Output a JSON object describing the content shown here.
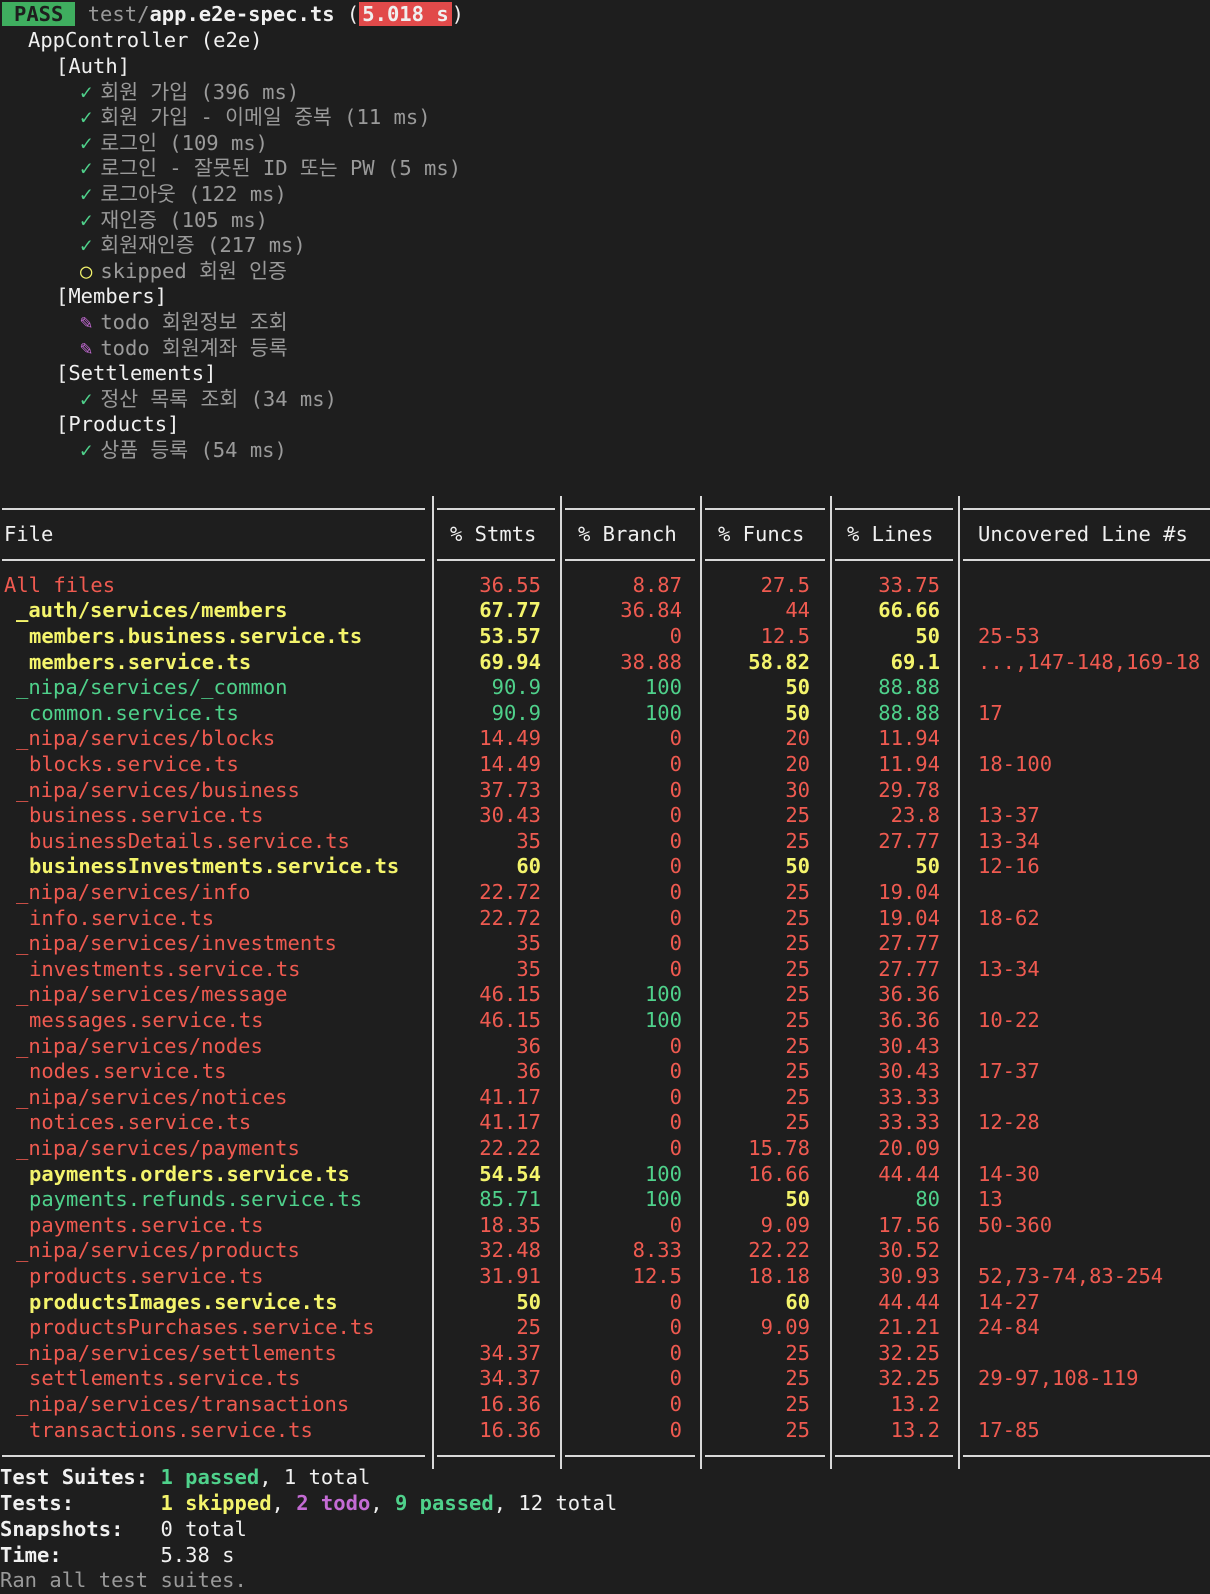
{
  "header": {
    "badge": "PASS",
    "path_dir": "test/",
    "path_file": "app.e2e-spec.ts",
    "open_paren": " (",
    "duration": "5.018 s",
    "close_paren": ")"
  },
  "suite": "AppController (e2e)",
  "groups": [
    {
      "name": "[Auth]",
      "tests": [
        {
          "mark": "✓",
          "status": "passed",
          "text": "회원 가입 (396 ms)"
        },
        {
          "mark": "✓",
          "status": "passed",
          "text": "회원 가입 - 이메일 중복 (11 ms)"
        },
        {
          "mark": "✓",
          "status": "passed",
          "text": "로그인 (109 ms)"
        },
        {
          "mark": "✓",
          "status": "passed",
          "text": "로그인 - 잘못된 ID 또는 PW (5 ms)"
        },
        {
          "mark": "✓",
          "status": "passed",
          "text": "로그아웃 (122 ms)"
        },
        {
          "mark": "✓",
          "status": "passed",
          "text": "재인증 (105 ms)"
        },
        {
          "mark": "✓",
          "status": "passed",
          "text": "회원재인증 (217 ms)"
        },
        {
          "mark": "○",
          "status": "skipped",
          "text": "skipped 회원 인증"
        }
      ]
    },
    {
      "name": "[Members]",
      "tests": [
        {
          "mark": "✎",
          "status": "todo",
          "text": "todo 회원정보 조회"
        },
        {
          "mark": "✎",
          "status": "todo",
          "text": "todo 회원계좌 등록"
        }
      ]
    },
    {
      "name": "[Settlements]",
      "tests": [
        {
          "mark": "✓",
          "status": "passed",
          "text": "정산 목록 조회 (34 ms)"
        }
      ]
    },
    {
      "name": "[Products]",
      "tests": [
        {
          "mark": "✓",
          "status": "passed",
          "text": "상품 등록 (54 ms)"
        }
      ]
    }
  ],
  "coverage": {
    "headers": [
      "File",
      "% Stmts",
      "% Branch",
      "% Funcs",
      "% Lines",
      "Uncovered Line #s"
    ],
    "rows": [
      {
        "file": "All files",
        "indent": 0,
        "color": "red",
        "bold": false,
        "stmts": "36.55",
        "branch": "8.87",
        "funcs": "27.5",
        "lines": "33.75",
        "uncovered": "",
        "colors": [
          "red",
          "red",
          "red",
          "red"
        ]
      },
      {
        "file": "_auth/services/members",
        "indent": 1,
        "color": "yellow",
        "bold": true,
        "stmts": "67.77",
        "branch": "36.84",
        "funcs": "44",
        "lines": "66.66",
        "uncovered": "",
        "colors": [
          "yellow",
          "red",
          "red",
          "yellow"
        ]
      },
      {
        "file": "members.business.service.ts",
        "indent": 2,
        "color": "yellow",
        "bold": true,
        "stmts": "53.57",
        "branch": "0",
        "funcs": "12.5",
        "lines": "50",
        "uncovered": "25-53",
        "colors": [
          "yellow",
          "red",
          "red",
          "yellow"
        ]
      },
      {
        "file": "members.service.ts",
        "indent": 2,
        "color": "yellow",
        "bold": true,
        "stmts": "69.94",
        "branch": "38.88",
        "funcs": "58.82",
        "lines": "69.1",
        "uncovered": "...,147-148,169-18",
        "colors": [
          "yellow",
          "red",
          "yellow",
          "yellow"
        ]
      },
      {
        "file": "_nipa/services/_common",
        "indent": 1,
        "color": "green",
        "bold": false,
        "stmts": "90.9",
        "branch": "100",
        "funcs": "50",
        "lines": "88.88",
        "uncovered": "",
        "colors": [
          "green",
          "green",
          "yellow",
          "green"
        ]
      },
      {
        "file": "common.service.ts",
        "indent": 2,
        "color": "green",
        "bold": false,
        "stmts": "90.9",
        "branch": "100",
        "funcs": "50",
        "lines": "88.88",
        "uncovered": "17",
        "colors": [
          "green",
          "green",
          "yellow",
          "green"
        ]
      },
      {
        "file": "_nipa/services/blocks",
        "indent": 1,
        "color": "red",
        "bold": false,
        "stmts": "14.49",
        "branch": "0",
        "funcs": "20",
        "lines": "11.94",
        "uncovered": "",
        "colors": [
          "red",
          "red",
          "red",
          "red"
        ]
      },
      {
        "file": "blocks.service.ts",
        "indent": 2,
        "color": "red",
        "bold": false,
        "stmts": "14.49",
        "branch": "0",
        "funcs": "20",
        "lines": "11.94",
        "uncovered": "18-100",
        "colors": [
          "red",
          "red",
          "red",
          "red"
        ]
      },
      {
        "file": "_nipa/services/business",
        "indent": 1,
        "color": "red",
        "bold": false,
        "stmts": "37.73",
        "branch": "0",
        "funcs": "30",
        "lines": "29.78",
        "uncovered": "",
        "colors": [
          "red",
          "red",
          "red",
          "red"
        ]
      },
      {
        "file": "business.service.ts",
        "indent": 2,
        "color": "red",
        "bold": false,
        "stmts": "30.43",
        "branch": "0",
        "funcs": "25",
        "lines": "23.8",
        "uncovered": "13-37",
        "colors": [
          "red",
          "red",
          "red",
          "red"
        ]
      },
      {
        "file": "businessDetails.service.ts",
        "indent": 2,
        "color": "red",
        "bold": false,
        "stmts": "35",
        "branch": "0",
        "funcs": "25",
        "lines": "27.77",
        "uncovered": "13-34",
        "colors": [
          "red",
          "red",
          "red",
          "red"
        ]
      },
      {
        "file": "businessInvestments.service.ts",
        "indent": 2,
        "color": "yellow",
        "bold": true,
        "stmts": "60",
        "branch": "0",
        "funcs": "50",
        "lines": "50",
        "uncovered": "12-16",
        "colors": [
          "yellow",
          "red",
          "yellow",
          "yellow"
        ]
      },
      {
        "file": "_nipa/services/info",
        "indent": 1,
        "color": "red",
        "bold": false,
        "stmts": "22.72",
        "branch": "0",
        "funcs": "25",
        "lines": "19.04",
        "uncovered": "",
        "colors": [
          "red",
          "red",
          "red",
          "red"
        ]
      },
      {
        "file": "info.service.ts",
        "indent": 2,
        "color": "red",
        "bold": false,
        "stmts": "22.72",
        "branch": "0",
        "funcs": "25",
        "lines": "19.04",
        "uncovered": "18-62",
        "colors": [
          "red",
          "red",
          "red",
          "red"
        ]
      },
      {
        "file": "_nipa/services/investments",
        "indent": 1,
        "color": "red",
        "bold": false,
        "stmts": "35",
        "branch": "0",
        "funcs": "25",
        "lines": "27.77",
        "uncovered": "",
        "colors": [
          "red",
          "red",
          "red",
          "red"
        ]
      },
      {
        "file": "investments.service.ts",
        "indent": 2,
        "color": "red",
        "bold": false,
        "stmts": "35",
        "branch": "0",
        "funcs": "25",
        "lines": "27.77",
        "uncovered": "13-34",
        "colors": [
          "red",
          "red",
          "red",
          "red"
        ]
      },
      {
        "file": "_nipa/services/message",
        "indent": 1,
        "color": "red",
        "bold": false,
        "stmts": "46.15",
        "branch": "100",
        "funcs": "25",
        "lines": "36.36",
        "uncovered": "",
        "colors": [
          "red",
          "green",
          "red",
          "red"
        ]
      },
      {
        "file": "messages.service.ts",
        "indent": 2,
        "color": "red",
        "bold": false,
        "stmts": "46.15",
        "branch": "100",
        "funcs": "25",
        "lines": "36.36",
        "uncovered": "10-22",
        "colors": [
          "red",
          "green",
          "red",
          "red"
        ]
      },
      {
        "file": "_nipa/services/nodes",
        "indent": 1,
        "color": "red",
        "bold": false,
        "stmts": "36",
        "branch": "0",
        "funcs": "25",
        "lines": "30.43",
        "uncovered": "",
        "colors": [
          "red",
          "red",
          "red",
          "red"
        ]
      },
      {
        "file": "nodes.service.ts",
        "indent": 2,
        "color": "red",
        "bold": false,
        "stmts": "36",
        "branch": "0",
        "funcs": "25",
        "lines": "30.43",
        "uncovered": "17-37",
        "colors": [
          "red",
          "red",
          "red",
          "red"
        ]
      },
      {
        "file": "_nipa/services/notices",
        "indent": 1,
        "color": "red",
        "bold": false,
        "stmts": "41.17",
        "branch": "0",
        "funcs": "25",
        "lines": "33.33",
        "uncovered": "",
        "colors": [
          "red",
          "red",
          "red",
          "red"
        ]
      },
      {
        "file": "notices.service.ts",
        "indent": 2,
        "color": "red",
        "bold": false,
        "stmts": "41.17",
        "branch": "0",
        "funcs": "25",
        "lines": "33.33",
        "uncovered": "12-28",
        "colors": [
          "red",
          "red",
          "red",
          "red"
        ]
      },
      {
        "file": "_nipa/services/payments",
        "indent": 1,
        "color": "red",
        "bold": false,
        "stmts": "22.22",
        "branch": "0",
        "funcs": "15.78",
        "lines": "20.09",
        "uncovered": "",
        "colors": [
          "red",
          "red",
          "red",
          "red"
        ]
      },
      {
        "file": "payments.orders.service.ts",
        "indent": 2,
        "color": "yellow",
        "bold": true,
        "stmts": "54.54",
        "branch": "100",
        "funcs": "16.66",
        "lines": "44.44",
        "uncovered": "14-30",
        "colors": [
          "yellow",
          "green",
          "red",
          "red"
        ]
      },
      {
        "file": "payments.refunds.service.ts",
        "indent": 2,
        "color": "green",
        "bold": false,
        "stmts": "85.71",
        "branch": "100",
        "funcs": "50",
        "lines": "80",
        "uncovered": "13",
        "colors": [
          "green",
          "green",
          "yellow",
          "green"
        ]
      },
      {
        "file": "payments.service.ts",
        "indent": 2,
        "color": "red",
        "bold": false,
        "stmts": "18.35",
        "branch": "0",
        "funcs": "9.09",
        "lines": "17.56",
        "uncovered": "50-360",
        "colors": [
          "red",
          "red",
          "red",
          "red"
        ]
      },
      {
        "file": "_nipa/services/products",
        "indent": 1,
        "color": "red",
        "bold": false,
        "stmts": "32.48",
        "branch": "8.33",
        "funcs": "22.22",
        "lines": "30.52",
        "uncovered": "",
        "colors": [
          "red",
          "red",
          "red",
          "red"
        ]
      },
      {
        "file": "products.service.ts",
        "indent": 2,
        "color": "red",
        "bold": false,
        "stmts": "31.91",
        "branch": "12.5",
        "funcs": "18.18",
        "lines": "30.93",
        "uncovered": "52,73-74,83-254",
        "colors": [
          "red",
          "red",
          "red",
          "red"
        ]
      },
      {
        "file": "productsImages.service.ts",
        "indent": 2,
        "color": "yellow",
        "bold": true,
        "stmts": "50",
        "branch": "0",
        "funcs": "60",
        "lines": "44.44",
        "uncovered": "14-27",
        "colors": [
          "yellow",
          "red",
          "yellow",
          "red"
        ]
      },
      {
        "file": "productsPurchases.service.ts",
        "indent": 2,
        "color": "red",
        "bold": false,
        "stmts": "25",
        "branch": "0",
        "funcs": "9.09",
        "lines": "21.21",
        "uncovered": "24-84",
        "colors": [
          "red",
          "red",
          "red",
          "red"
        ]
      },
      {
        "file": "_nipa/services/settlements",
        "indent": 1,
        "color": "red",
        "bold": false,
        "stmts": "34.37",
        "branch": "0",
        "funcs": "25",
        "lines": "32.25",
        "uncovered": "",
        "colors": [
          "red",
          "red",
          "red",
          "red"
        ]
      },
      {
        "file": "settlements.service.ts",
        "indent": 2,
        "color": "red",
        "bold": false,
        "stmts": "34.37",
        "branch": "0",
        "funcs": "25",
        "lines": "32.25",
        "uncovered": "29-97,108-119",
        "colors": [
          "red",
          "red",
          "red",
          "red"
        ]
      },
      {
        "file": "_nipa/services/transactions",
        "indent": 1,
        "color": "red",
        "bold": false,
        "stmts": "16.36",
        "branch": "0",
        "funcs": "25",
        "lines": "13.2",
        "uncovered": "",
        "colors": [
          "red",
          "red",
          "red",
          "red"
        ]
      },
      {
        "file": "transactions.service.ts",
        "indent": 2,
        "color": "red",
        "bold": false,
        "stmts": "16.36",
        "branch": "0",
        "funcs": "25",
        "lines": "13.2",
        "uncovered": "17-85",
        "colors": [
          "red",
          "red",
          "red",
          "red"
        ]
      }
    ]
  },
  "summary": {
    "suites_label": "Test Suites: ",
    "suites_passed": "1 passed",
    "suites_total": ", 1 total",
    "tests_label": "Tests:       ",
    "tests_skipped": "1 skipped",
    "tests_sep1": ", ",
    "tests_todo": "2 todo",
    "tests_sep2": ", ",
    "tests_passed": "9 passed",
    "tests_total": ", 12 total",
    "snapshots_label": "Snapshots:   ",
    "snapshots_value": "0 total",
    "time_label": "Time:        ",
    "time_value": "5.38 s",
    "footer": "Ran all test suites."
  },
  "colors": {
    "background": "#1e1e1e",
    "green": "#4fd18b",
    "yellow": "#f4f46c",
    "red": "#ef5a50",
    "magenta": "#c46bd4",
    "pass_badge": "#3fae5f",
    "time_badge": "#e14a4a"
  }
}
